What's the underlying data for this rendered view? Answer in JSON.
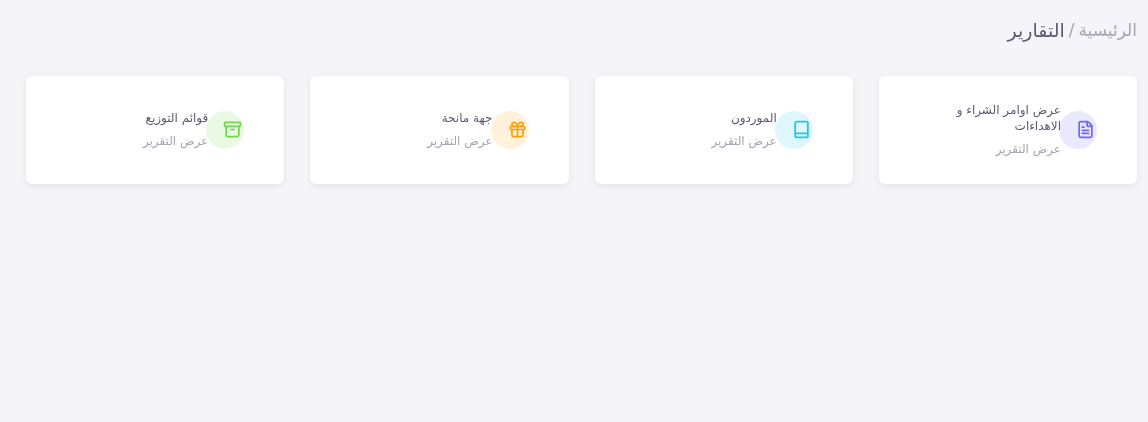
{
  "breadcrumb": {
    "home": "الرئيسية",
    "separator": "/",
    "current": "التقارير"
  },
  "cards": [
    {
      "title": "عرض اوامر الشراء و الاهداءات",
      "link": "عرض التقرير",
      "kind": "document",
      "color": "#7367f0"
    },
    {
      "title": "الموردون",
      "link": "عرض التقرير",
      "kind": "book",
      "color": "#22c8e8"
    },
    {
      "title": "جهة مانحة",
      "link": "عرض التقرير",
      "kind": "gift",
      "color": "#ff9f0a"
    },
    {
      "title": "قوائم التوزيع",
      "link": "عرض التقرير",
      "kind": "archive",
      "color": "#6dd94a"
    }
  ]
}
